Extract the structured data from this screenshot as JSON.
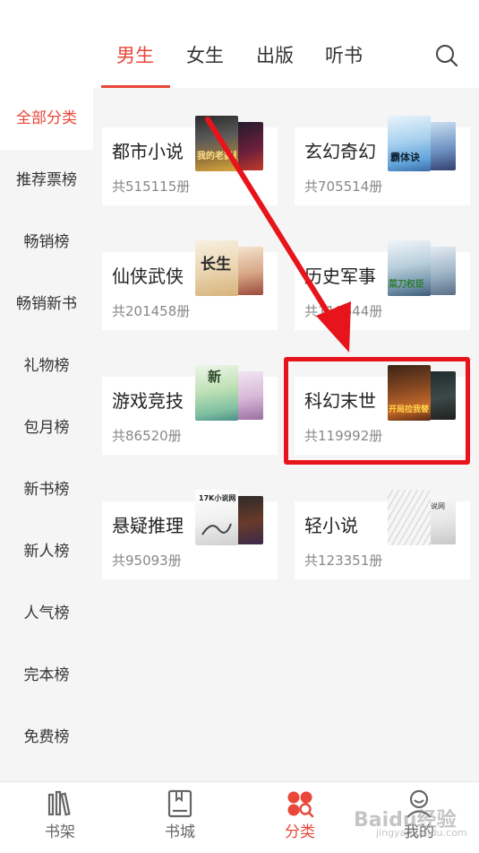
{
  "top_tabs": [
    {
      "label": "男生",
      "active": true
    },
    {
      "label": "女生",
      "active": false
    },
    {
      "label": "出版",
      "active": false
    },
    {
      "label": "听书",
      "active": false
    }
  ],
  "search_icon": "search-icon",
  "sidebar": {
    "items": [
      {
        "label": "全部分类",
        "active": true
      },
      {
        "label": "推荐票榜"
      },
      {
        "label": "畅销榜"
      },
      {
        "label": "畅销新书"
      },
      {
        "label": "礼物榜"
      },
      {
        "label": "包月榜"
      },
      {
        "label": "新书榜"
      },
      {
        "label": "新人榜"
      },
      {
        "label": "人气榜"
      },
      {
        "label": "完本榜"
      },
      {
        "label": "免费榜"
      }
    ]
  },
  "categories": [
    {
      "title": "都市小说",
      "count": "共515115册",
      "cover_text": "我的老婆是兵王"
    },
    {
      "title": "玄幻奇幻",
      "count": "共705514册",
      "cover_text": "霸体诀"
    },
    {
      "title": "仙侠武侠",
      "count": "共201458册",
      "cover_text": "长生"
    },
    {
      "title": "历史军事",
      "count": "共118644册",
      "cover_text": "菜刀权臣"
    },
    {
      "title": "游戏竞技",
      "count": "共86520册",
      "cover_text": "新"
    },
    {
      "title": "科幻末世",
      "count": "共119992册",
      "cover_text": "开局拉我替身"
    },
    {
      "title": "悬疑推理",
      "count": "共95093册",
      "cover_text": "17K小说网"
    },
    {
      "title": "轻小说",
      "count": "共123351册",
      "cover_text": "小说网"
    }
  ],
  "bottom_nav": [
    {
      "label": "书架",
      "icon": "bookshelf-icon",
      "active": false
    },
    {
      "label": "书城",
      "icon": "bookstore-icon",
      "active": false
    },
    {
      "label": "分类",
      "icon": "category-icon",
      "active": true
    },
    {
      "label": "我的",
      "icon": "profile-icon",
      "active": false
    }
  ],
  "colors": {
    "accent": "#e8473a",
    "highlight": "#e8141c",
    "sidebar_bg": "#f5f5f5"
  },
  "watermark": {
    "text": "Baidu经验",
    "sub": "jingyan.baidu.com"
  }
}
